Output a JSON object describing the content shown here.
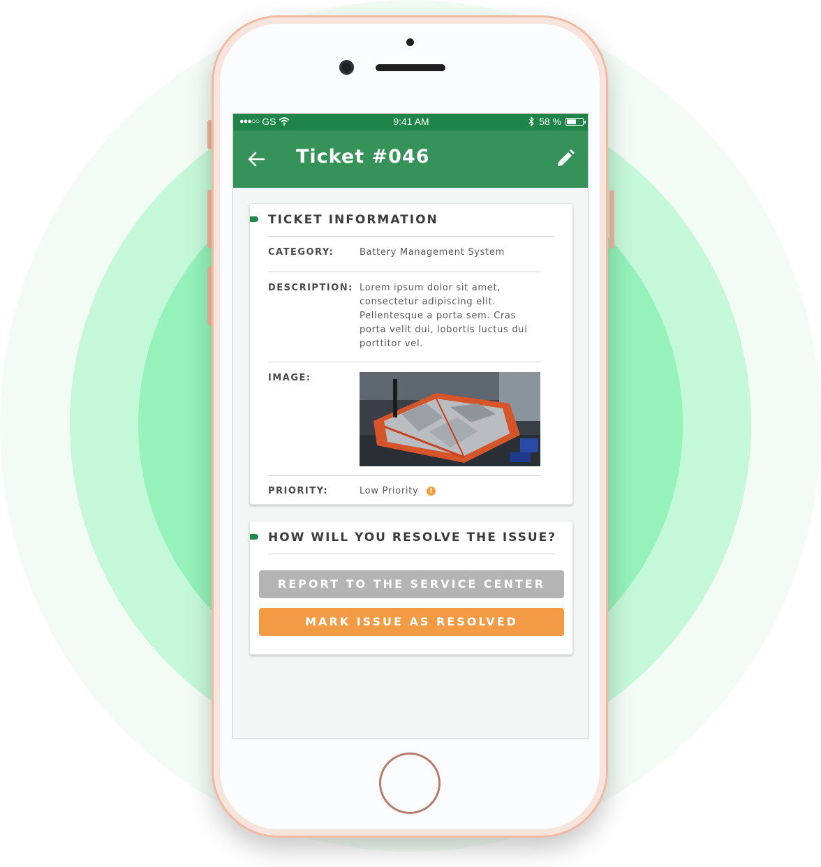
{
  "status_bar": {
    "carrier": "GS",
    "time": "9:41 AM",
    "battery_text": "58 %",
    "battery_level": 0.58
  },
  "app_bar": {
    "title": "Ticket #046",
    "back_icon": "arrow-left-icon",
    "edit_icon": "pencil-icon"
  },
  "ticket_info": {
    "heading": "TICKET INFORMATION",
    "category_label": "CATEGORY:",
    "category_value": "Battery Management System",
    "description_label": "DESCRIPTION:",
    "description_value": "Lorem ipsum dolor sit amet, consectetur adipiscing elit. Pellentesque a porta sem. Cras porta velit dui, lobortis luctus dui porttitor vel.",
    "image_label": "IMAGE:",
    "priority_label": "PRIORITY:",
    "priority_value": "Low Priority",
    "priority_icon": "info-icon",
    "priority_info_glyph": "!"
  },
  "resolve": {
    "heading": "HOW WILL YOU RESOLVE THE ISSUE?",
    "report_button": "REPORT TO THE SERVICE CENTER",
    "resolve_button": "MARK ISSUE AS RESOLVED"
  },
  "colors": {
    "status_bar": "#1e8448",
    "app_bar": "#359359",
    "accent_marker": "#1f8a45",
    "button_gray": "#b4b4b4",
    "button_orange": "#f39a45",
    "priority_info": "#f0a13e"
  }
}
